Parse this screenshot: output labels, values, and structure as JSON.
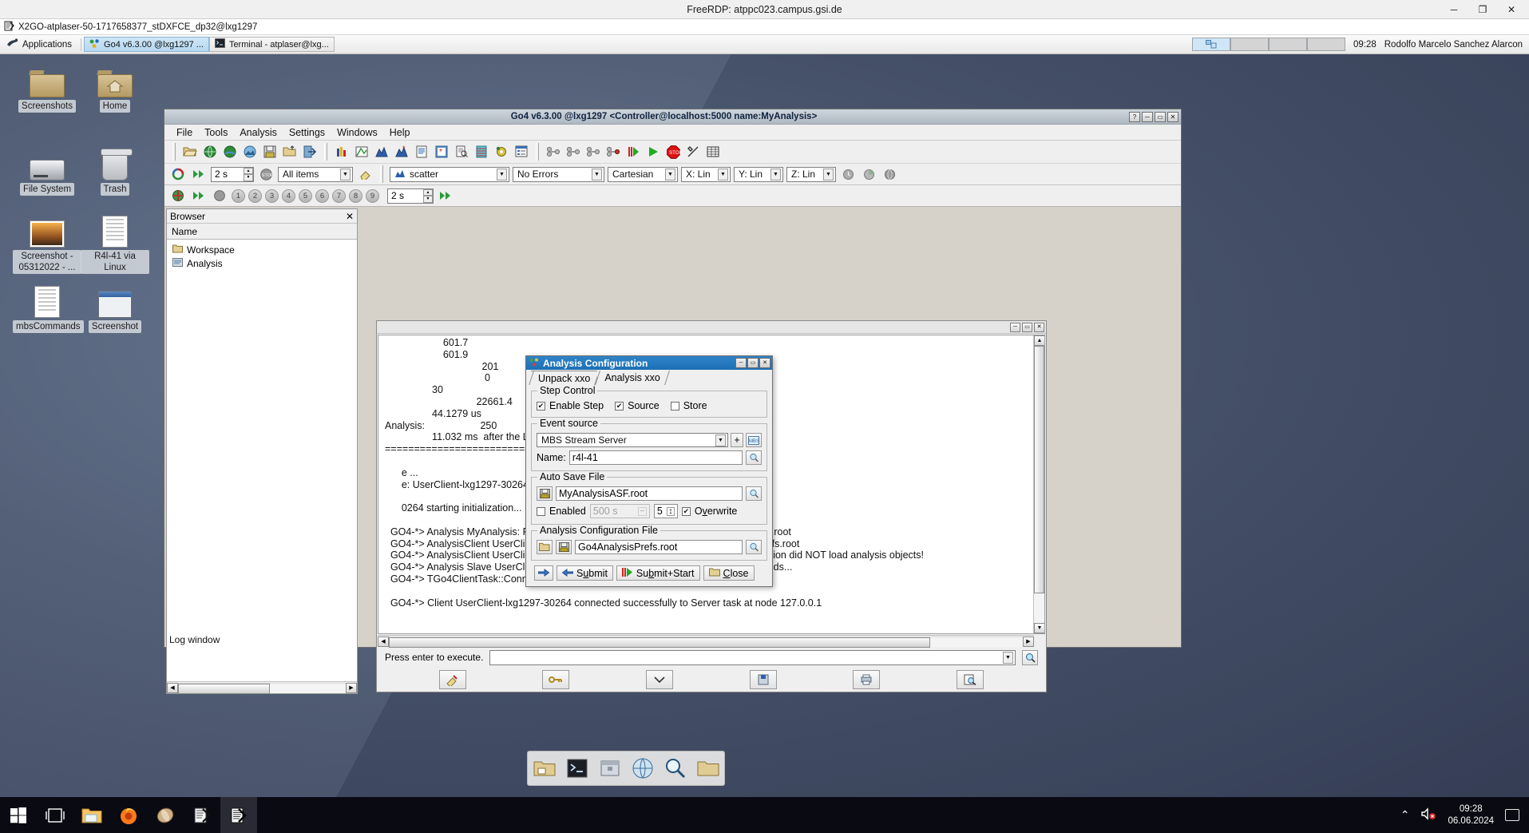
{
  "rdp": {
    "title": "FreeRDP: atppc023.campus.gsi.de",
    "minimize": "─",
    "restore": "❐",
    "close": "✕"
  },
  "x2go": {
    "title": "X2GO-atplaser-50-1717658377_stDXFCE_dp32@lxg1297",
    "icon": "x2go-icon"
  },
  "xfce_panel": {
    "applications_label": "Applications",
    "tasks": [
      {
        "label": "Go4 v6.3.00 @lxg1297 ...",
        "icon": "go4-icon",
        "active": true
      },
      {
        "label": "Terminal - atplaser@lxg...",
        "icon": "terminal-icon",
        "active": false
      }
    ],
    "clock": "09:28",
    "user": "Rodolfo Marcelo Sanchez Alarcon",
    "workspaces": [
      1,
      2,
      3,
      4
    ],
    "active_workspace": 1
  },
  "desktop": {
    "icons": [
      {
        "label": "Screenshots",
        "icon": "folder-icon"
      },
      {
        "label": "Home",
        "icon": "home-folder-icon"
      },
      {
        "label": "File System",
        "icon": "harddisk-icon"
      },
      {
        "label": "Trash",
        "icon": "trash-icon"
      },
      {
        "label": "Screenshot - 05312022 - ...",
        "icon": "image-file-icon"
      },
      {
        "label": "R4l-41 via Linux",
        "icon": "text-file-icon"
      },
      {
        "label": "mbsCommands",
        "icon": "text-file-icon"
      },
      {
        "label": "Screenshot",
        "icon": "window-image-icon"
      }
    ]
  },
  "go4": {
    "title": "Go4 v6.3.00 @lxg1297 <Controller@localhost:5000 name:MyAnalysis>",
    "window_buttons": {
      "help": "?",
      "minimize": "─",
      "maximize": "▭",
      "close": "✕"
    },
    "menu": [
      "File",
      "Tools",
      "Analysis",
      "Settings",
      "Windows",
      "Help"
    ],
    "toolbar_icons": [
      "open-file-icon",
      "browse-remote-icon",
      "connect-globe-icon",
      "http-server-icon",
      "save-icon",
      "save-as-icon",
      "exit-icon",
      "histogram-icon",
      "condition-icon",
      "draw-histogram-icon",
      "draw-marked-icon",
      "tree-viewer-icon",
      "create-condition-icon",
      "inspect-icon",
      "parameter-icon",
      "settings-gear-icon",
      "window-list-icon",
      "analysis-config-icon",
      "analysis-submit-icon",
      "analysis-start-disabled-icon",
      "analysis-start-icon",
      "start-all-icon",
      "start-icon",
      "stop-icon",
      "tools-icon",
      "status-table-icon"
    ],
    "toolbar2": {
      "refresh_icon": "refresh-icon",
      "fastforward_icon": "fast-forward-icon",
      "interval_value": "2 s",
      "stop_icon": "stop-sign-icon",
      "filter_value": "All items",
      "eraser_icon": "eraser-icon",
      "draw_mode_value": "scatter",
      "draw_mode_icon": "scatter-icon",
      "errors_value": "No Errors",
      "coord_value": "Cartesian",
      "x_scale_value": "X: Lin",
      "y_scale_value": "Y: Lin",
      "z_scale_value": "Z: Lin",
      "extra_icons": [
        "clock-icon",
        "pie-icon",
        "sphere-icon"
      ]
    },
    "toolbar3": {
      "grid_icon": "grid-icon",
      "pads": [
        "1",
        "2",
        "3",
        "4",
        "5",
        "6",
        "7",
        "8",
        "9"
      ],
      "interval_value": "2 s",
      "run_icon": "run-fast-icon"
    },
    "browser": {
      "title": "Browser",
      "close_icon": "close-icon",
      "column_header": "Name",
      "items": [
        {
          "label": "Workspace",
          "icon": "folder-icon"
        },
        {
          "label": "Analysis",
          "icon": "analysis-icon"
        }
      ]
    },
    "statusbar": {
      "label": "Log window"
    },
    "logwindow": {
      "window_buttons": {
        "minimize": "─",
        "maximize": "▭",
        "close": "✕"
      },
      "text": "                     601.7\n                     601.9\n                                   201\n                                    0\n                 30\n                                 22661.4\n                 44.1279 us\nAnalysis:                    250\n                 11.032 ms  after the Laser Shot\n=================================================\n\n      e ...\n      e: UserClient-lxg1297-30264\n\n      0264 starting initialization...\n\n  GO4-*> Analysis MyAnalysis: Found status object MyAnalysis in file Go4AnalysisPrefs.root\n  GO4-*> AnalysisClient UserClient-lxg1297-30264: Status loaded from Go4AnalysisPrefs.root\n  GO4-*> AnalysisClient UserClient-lxg1297-30264: AUTOSAVE is DISABLED, Initialization did NOT load analysis objects!\n  GO4-*> Analysis Slave UserClient-lxg1297-30264 waiting for submit and start commands...\n  GO4-*> TGo4ClientTask::ConnectServer with role 0 and passwd (null)\n\n  GO4-*> Client UserClient-lxg1297-30264 connected successfully to Server task at node 127.0.0.1",
      "prompt_label": "Press enter to execute.",
      "command_value": "",
      "command_search_icon": "search-icon",
      "footer_icons": [
        "clear-log-icon",
        "key-icon",
        "dropdown-icon",
        "save-log-icon",
        "print-icon",
        "find-icon"
      ]
    }
  },
  "dialog": {
    "title": "Analysis Configuration",
    "title_icon": "analysis-config-icon",
    "window_buttons": {
      "minimize": "─",
      "maximize": "▭",
      "close": "✕"
    },
    "tabs": [
      {
        "label": "Unpack xxo",
        "selected": true
      },
      {
        "label": "Analysis xxo",
        "selected": false
      }
    ],
    "step_control": {
      "legend": "Step Control",
      "enable_step": {
        "label": "Enable Step",
        "checked": true
      },
      "source": {
        "label": "Source",
        "checked": true
      },
      "store": {
        "label": "Store",
        "checked": false
      }
    },
    "event_source": {
      "legend": "Event source",
      "type_value": "MBS Stream Server",
      "add_button": "+",
      "mbs_icon": "mbs-icon",
      "name_label": "Name:",
      "name_value": "r4l-41",
      "browse_icon": "browse-icon"
    },
    "auto_save": {
      "legend": "Auto Save File",
      "save_icon": "floppy-icon",
      "file_value": "MyAnalysisASF.root",
      "browse_icon": "browse-icon",
      "enabled": {
        "label": "Enabled",
        "checked": false
      },
      "interval_value": "500 s",
      "compression_value": "5",
      "overwrite": {
        "label": "Overwrite",
        "checked": true
      }
    },
    "config_file": {
      "legend": "Analysis Configuration File",
      "open_icon": "open-folder-icon",
      "save_icon": "floppy-icon",
      "file_value": "Go4AnalysisPrefs.root",
      "browse_icon": "browse-icon"
    },
    "buttons": [
      {
        "label": "",
        "icon": "arrow-right-icon",
        "name": "apply-button"
      },
      {
        "label": "Submit",
        "icon": "arrow-left-icon",
        "name": "submit-button"
      },
      {
        "label": "Submit+Start",
        "icon": "start-icon",
        "name": "submit-start-button"
      },
      {
        "label": "Close",
        "icon": "close-folder-icon",
        "name": "close-button"
      }
    ]
  },
  "dock": {
    "items": [
      "files-icon",
      "terminal-icon",
      "archive-icon",
      "browser-icon",
      "search-icon",
      "folder-icon"
    ]
  },
  "taskbar": {
    "items": [
      "start-icon",
      "task-view-icon",
      "explorer-icon",
      "firefox-icon",
      "app-icon",
      "xming-icon",
      "x2go-icon"
    ],
    "active_index": 6,
    "tray": {
      "expand": "⌃",
      "volume": "volume-muted-icon"
    },
    "time": "09:28",
    "date": "06.06.2024",
    "notifications_icon": "notification-icon"
  }
}
